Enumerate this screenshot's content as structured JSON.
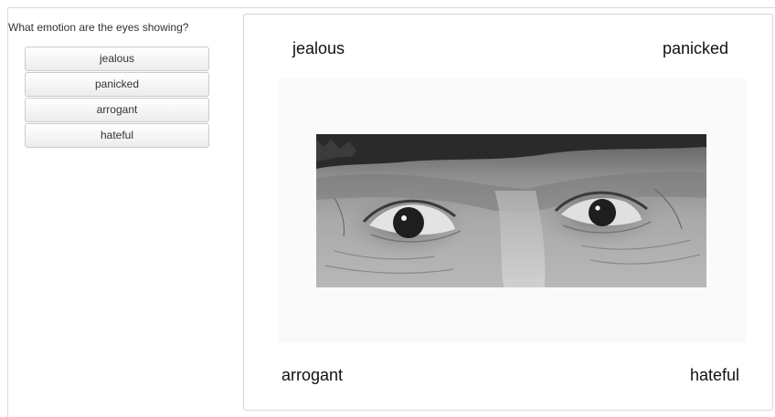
{
  "question": "What emotion are the eyes showing?",
  "options": [
    {
      "label": "jealous"
    },
    {
      "label": "panicked"
    },
    {
      "label": "arrogant"
    },
    {
      "label": "hateful"
    }
  ],
  "stage": {
    "top_left": "jealous",
    "top_right": "panicked",
    "bottom_left": "arrogant",
    "bottom_right": "hateful"
  },
  "colors": {
    "button_border": "#cccccc",
    "text": "#333333",
    "panel_border": "#d6d6d6"
  }
}
